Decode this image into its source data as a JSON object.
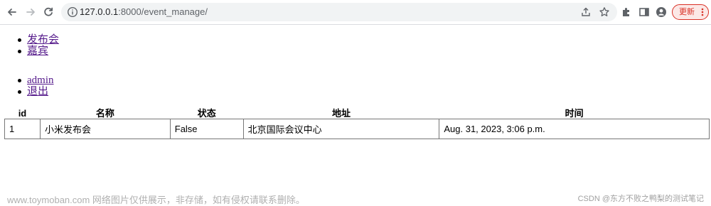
{
  "browser": {
    "url_host": "127.0.0.1",
    "url_rest": ":8000/event_manage/",
    "update_label": "更新"
  },
  "nav_primary": [
    {
      "label": "发布会"
    },
    {
      "label": "嘉宾"
    }
  ],
  "nav_user": [
    {
      "label": "admin"
    },
    {
      "label": "退出"
    }
  ],
  "table": {
    "headers": [
      "id",
      "名称",
      "状态",
      "地址",
      "时间"
    ],
    "rows": [
      {
        "id": "1",
        "name": "小米发布会",
        "status": "False",
        "address": "北京国际会议中心",
        "time": "Aug. 31, 2023, 3:06 p.m."
      }
    ]
  },
  "watermark": "www.toymoban.com 网络图片仅供展示，非存储，如有侵权请联系删除。",
  "credit": "CSDN @东方不败之鸭梨的测试笔记"
}
